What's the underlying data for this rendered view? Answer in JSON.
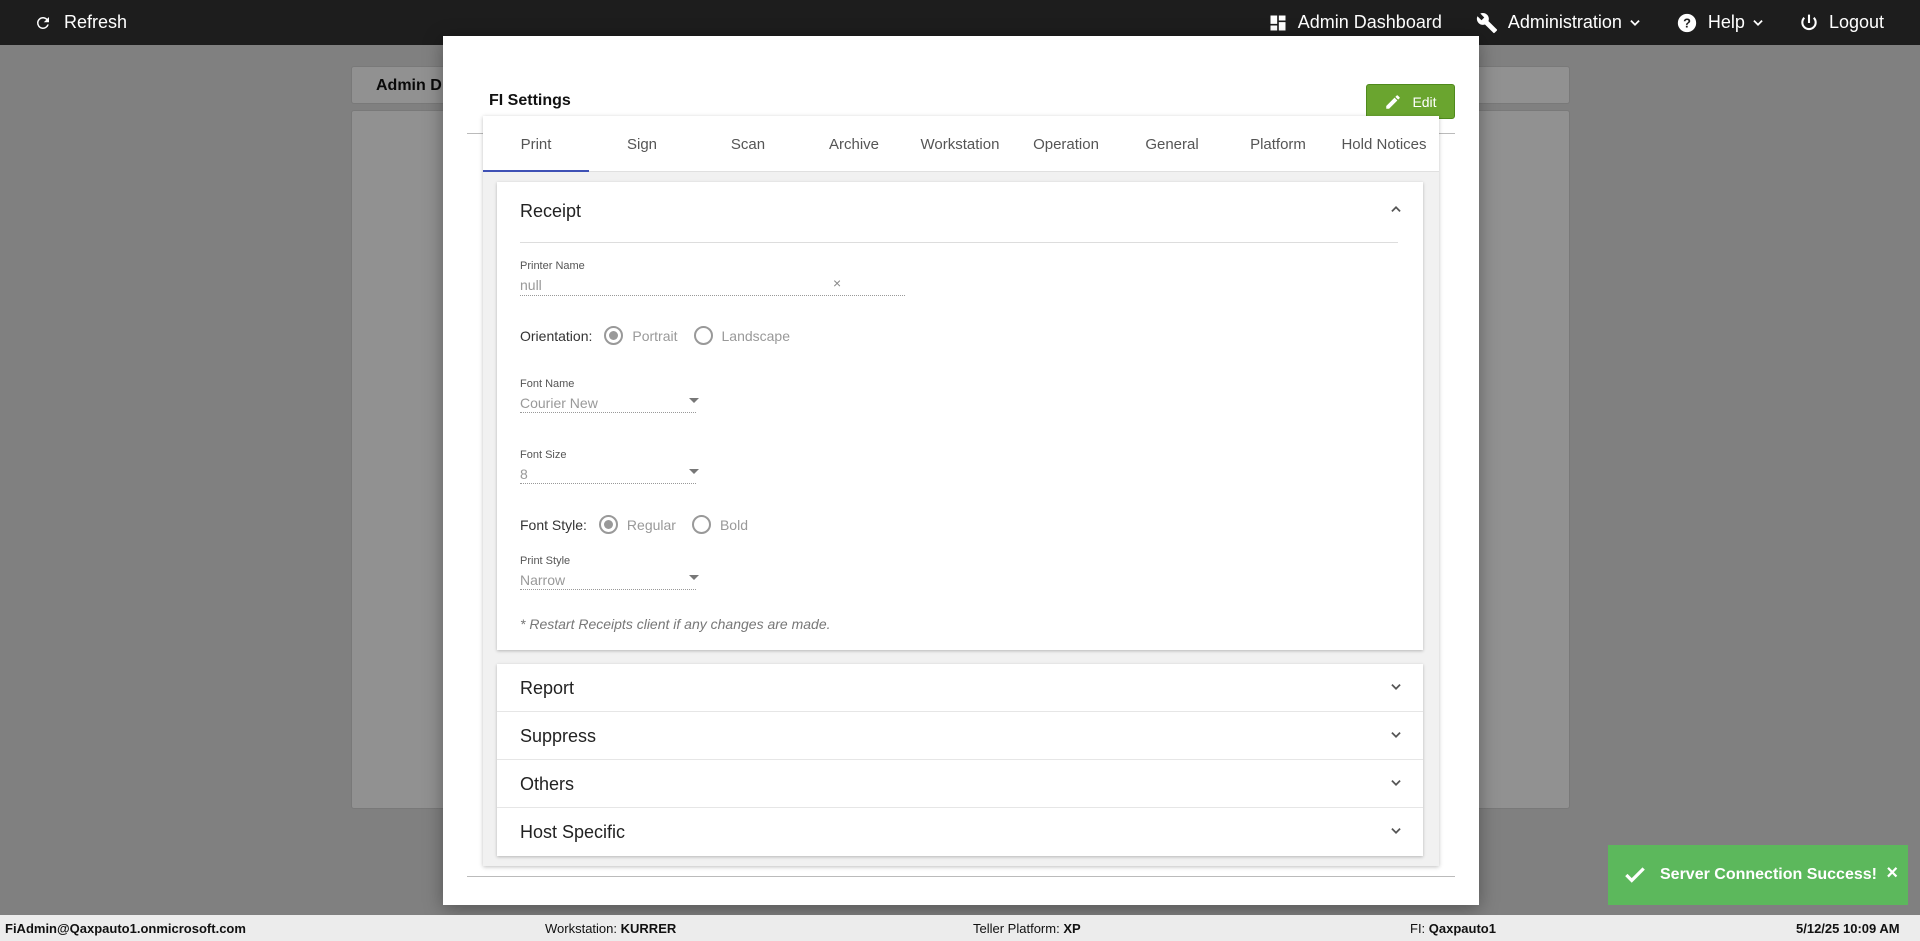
{
  "topbar": {
    "refresh_label": "Refresh",
    "admin_dashboard_label": "Admin Dashboard",
    "administration_label": "Administration",
    "help_label": "Help",
    "logout_label": "Logout"
  },
  "background": {
    "tab_title": "Admin D"
  },
  "modal": {
    "title": "FI Settings",
    "edit_label": "Edit",
    "tabs": [
      {
        "label": "Print"
      },
      {
        "label": "Sign"
      },
      {
        "label": "Scan"
      },
      {
        "label": "Archive"
      },
      {
        "label": "Workstation"
      },
      {
        "label": "Operation"
      },
      {
        "label": "General"
      },
      {
        "label": "Platform"
      },
      {
        "label": "Hold Notices"
      }
    ],
    "receipt": {
      "title": "Receipt",
      "printer_name_label": "Printer Name",
      "printer_name_value": "null",
      "clear_symbol": "×",
      "orientation_label": "Orientation:",
      "orientation_options": [
        "Portrait",
        "Landscape"
      ],
      "font_name_label": "Font Name",
      "font_name_value": "Courier New",
      "font_size_label": "Font Size",
      "font_size_value": "8",
      "font_style_label": "Font Style:",
      "font_style_options": [
        "Regular",
        "Bold"
      ],
      "print_style_label": "Print Style",
      "print_style_value": "Narrow",
      "note": "* Restart Receipts client if any changes are made."
    },
    "sections": [
      {
        "title": "Report"
      },
      {
        "title": "Suppress"
      },
      {
        "title": "Others"
      },
      {
        "title": "Host Specific"
      }
    ]
  },
  "toast": {
    "message": "Server Connection Success!",
    "close": "×"
  },
  "statusbar": {
    "user": "FiAdmin@Qaxpauto1.onmicrosoft.com",
    "workstation_label": "Workstation:",
    "workstation_value": "KURRER",
    "teller_label": "Teller Platform:",
    "teller_value": "XP",
    "fi_label": "FI:",
    "fi_value": "Qaxpauto1",
    "datetime": "5/12/25 10:09 AM"
  },
  "colors": {
    "topbar_bg": "#1d1d1d",
    "edit_button": "#6aa52f",
    "tab_indicator": "#3f51b5",
    "toast_bg": "#5cb85c"
  }
}
